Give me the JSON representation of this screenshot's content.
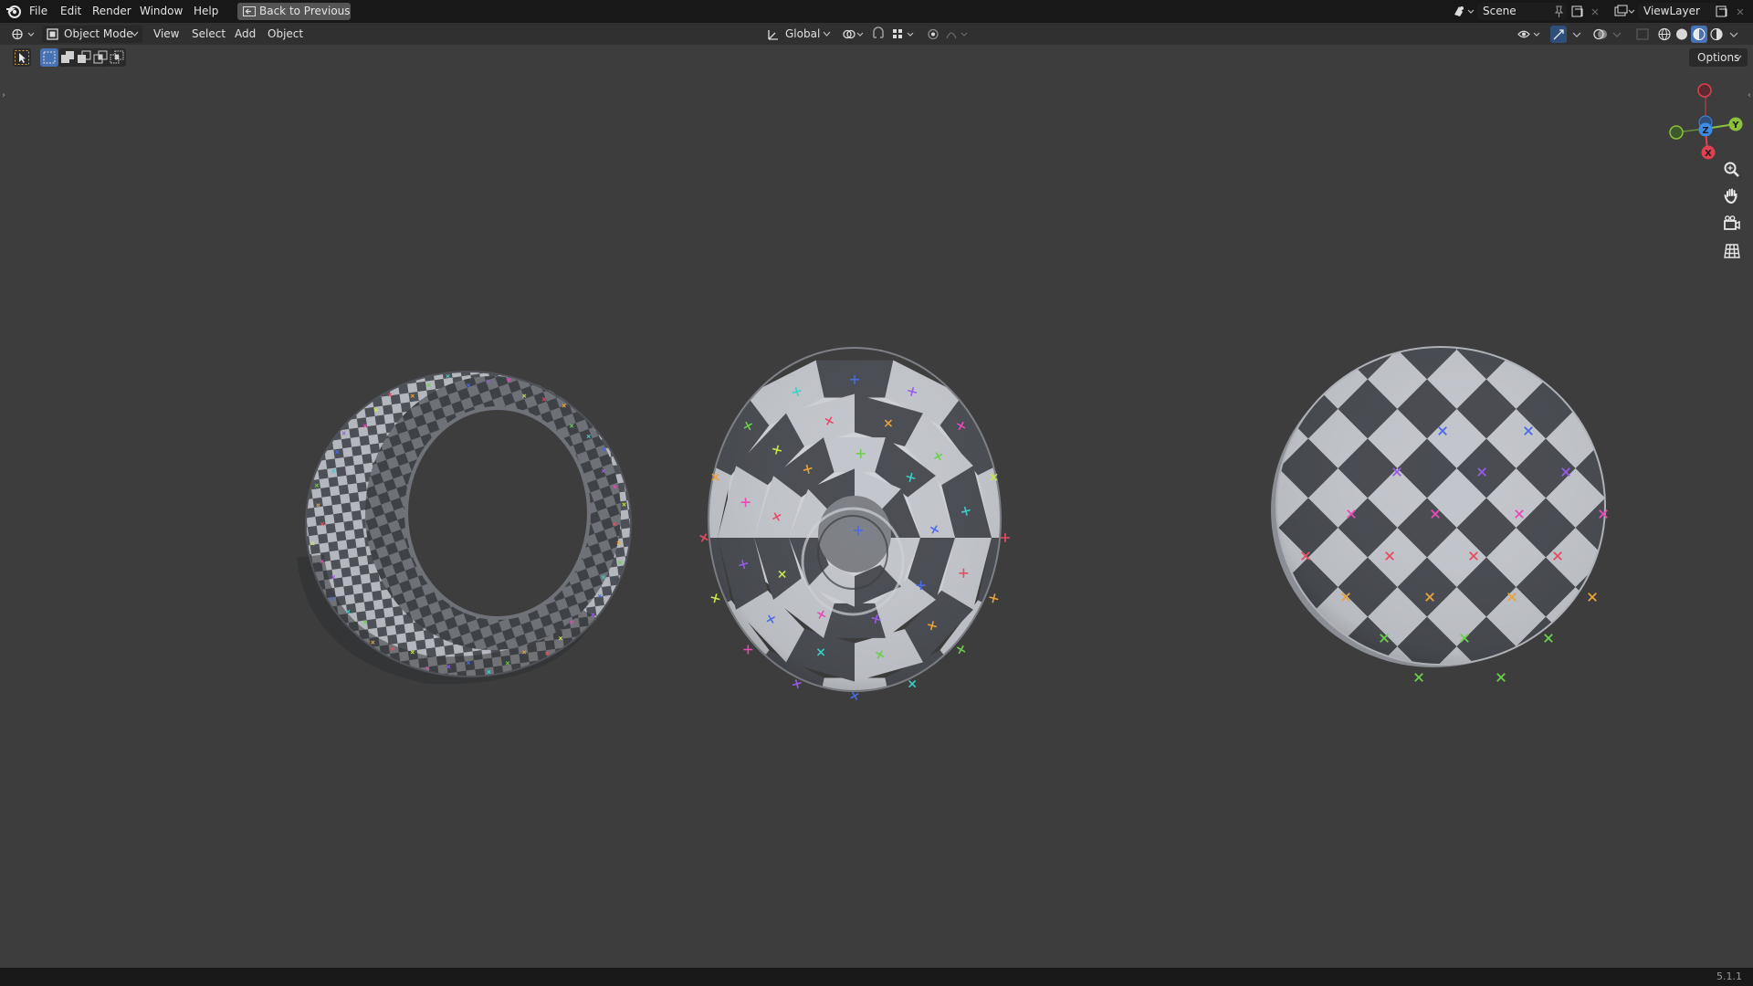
{
  "topbar": {
    "menus": [
      "File",
      "Edit",
      "Render",
      "Window",
      "Help"
    ],
    "back_button": "Back to Previous",
    "scene": "Scene",
    "view_layer": "ViewLayer"
  },
  "header": {
    "mode": "Object Mode",
    "menus": [
      "View",
      "Select",
      "Add",
      "Object"
    ],
    "orientation": "Global"
  },
  "viewport": {
    "options_label": "Options",
    "gizmo": {
      "x": "X",
      "y": "Y",
      "z": "Z"
    },
    "objects": [
      "open-tube",
      "ring-cylinder",
      "checker-disc"
    ]
  },
  "statusbar": {
    "version": "5.1.1"
  },
  "colors": {
    "background": "#3d3d3d",
    "topbar": "#181818",
    "header": "#303030",
    "checker_light": "#b9bcc2",
    "checker_dark": "#4d5056",
    "axis_x": "#e0404f",
    "axis_y": "#8bc13c",
    "axis_z": "#3d8ce8"
  }
}
